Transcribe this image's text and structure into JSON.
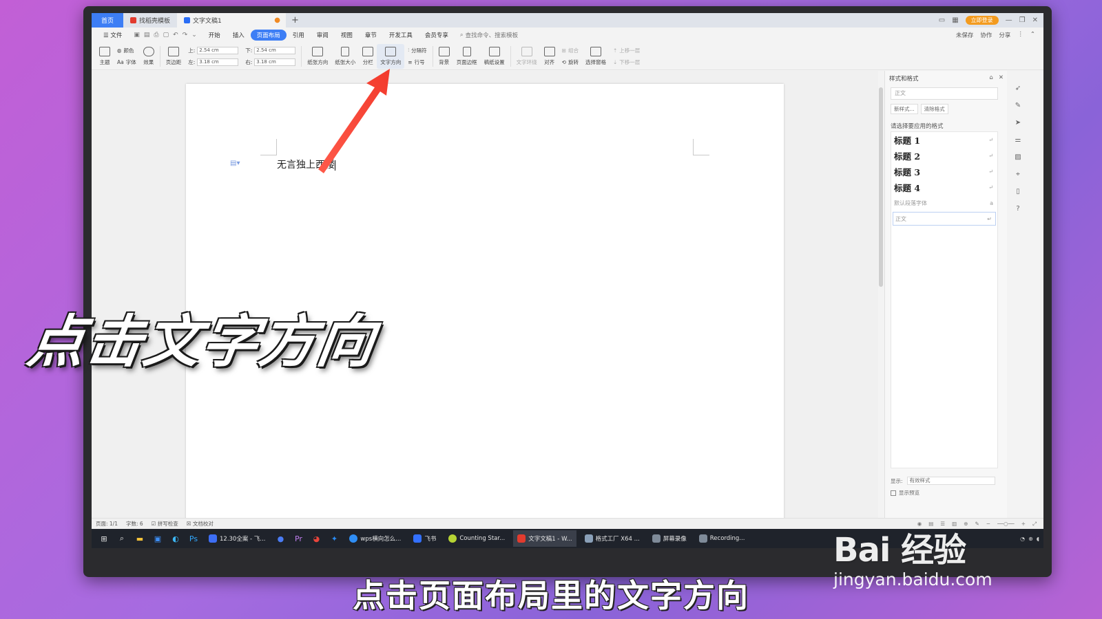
{
  "titlebar": {
    "home_tab": "首页",
    "template_tab": "找稻壳模板",
    "doc_tab": "文字文稿1",
    "doc_tab_dot": "●",
    "new_tab": "+",
    "login_label": "立即登录",
    "window_controls": [
      "—",
      "❐",
      "✕"
    ]
  },
  "menubar": {
    "file": "文件",
    "items": [
      "开始",
      "插入",
      "页面布局",
      "引用",
      "审阅",
      "视图",
      "章节",
      "开发工具",
      "会员专享"
    ],
    "active": "页面布局",
    "search": "查找命令、搜索模板",
    "right": [
      "未保存",
      "协作",
      "分享"
    ]
  },
  "ribbon": {
    "theme": "主题",
    "color": "颜色",
    "font": "字体",
    "effect": "效果",
    "margins": "页边距",
    "top_label": "上:",
    "top_value": "2.54 cm",
    "bottom_label": "下:",
    "bottom_value": "2.54 cm",
    "left_label": "左:",
    "left_value": "3.18 cm",
    "right_label": "右:",
    "right_value": "3.18 cm",
    "orientation": "纸张方向",
    "size": "纸张大小",
    "columns": "分栏",
    "text_direction": "文字方向",
    "breaks": "分隔符",
    "line_numbers": "行号",
    "background": "背景",
    "page_border": "页面边框",
    "manuscript": "稿纸设置",
    "wrap": "文字环绕",
    "align": "对齐",
    "group": "组合",
    "rotate": "旋转",
    "select_pane": "选择窗格",
    "bring_forward": "上移一层",
    "send_backward": "下移一层"
  },
  "document": {
    "text": "无言独上西楼"
  },
  "panel": {
    "title": "样式和格式",
    "current_style": "正文",
    "new_style": "新样式...",
    "clear_format": "清除格式",
    "prompt": "请选择要应用的格式",
    "styles": [
      "标题  1",
      "标题  2",
      "标题  3",
      "标题  4"
    ],
    "default_font": "默认段落字体",
    "normal": "正文",
    "show_label": "显示:",
    "show_value": "有效样式",
    "preview": "显示预览"
  },
  "statusbar": {
    "page": "页面: 1/1",
    "words": "字数: 6",
    "spell": "拼写检查",
    "proof": "文档校对"
  },
  "taskbar": {
    "apps": [
      "12.30全案 - 飞...",
      "wps横向怎么...",
      "飞书",
      "Counting Star...",
      "文字文稿1 - W...",
      "格式工厂 X64 ...",
      "屏幕录像",
      "Recording..."
    ],
    "active": "文字文稿1 - W..."
  },
  "overlay": {
    "headline": "点击文字方向",
    "subtitle": "点击页面布局里的文字方向"
  },
  "watermark": {
    "logo": "Bai 经验",
    "url": "jingyan.baidu.com"
  }
}
